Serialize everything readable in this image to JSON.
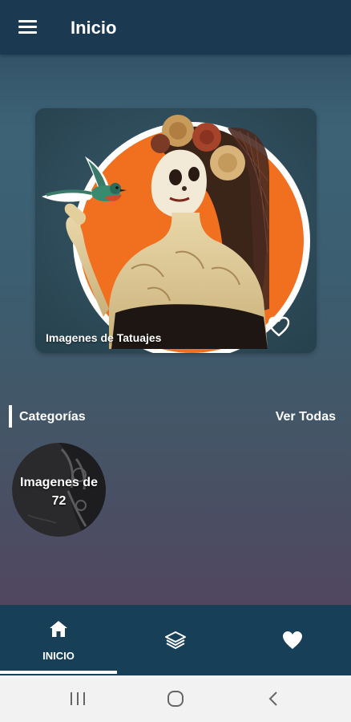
{
  "appbar": {
    "title": "Inicio",
    "menu_icon": "menu-icon"
  },
  "featured": {
    "label": "Imagenes de Tatuajes",
    "favorite_icon": "heart-outline-icon"
  },
  "categories_section": {
    "title": "Categorías",
    "see_all": "Ver Todas",
    "items": [
      {
        "label_line1": "Imagenes de",
        "label_line2": "72"
      }
    ]
  },
  "bottom_nav": {
    "items": [
      {
        "label": "INICIO",
        "icon": "home-icon",
        "active": true
      },
      {
        "label": "",
        "icon": "layers-icon",
        "active": false
      },
      {
        "label": "",
        "icon": "heart-icon",
        "active": false
      }
    ]
  },
  "system_nav": {
    "icons": [
      "recents-icon",
      "home-circle-icon",
      "back-icon"
    ]
  },
  "colors": {
    "appbar": "#1b3a52",
    "bottom_nav": "#173f57",
    "accent_orange": "#f07020",
    "text": "#ffffff"
  }
}
